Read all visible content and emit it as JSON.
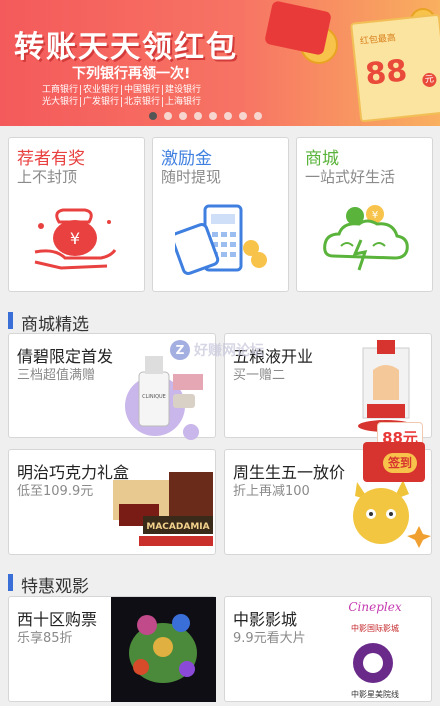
{
  "banner": {
    "title": "转账天天领红包",
    "subtitle": "下列银行再领一次!",
    "banks_row1": [
      "工商银行",
      "农业银行",
      "中国银行",
      "建设银行"
    ],
    "banks_row2": [
      "光大银行",
      "广发银行",
      "北京银行",
      "上海银行"
    ],
    "envelope_label": "红包最高",
    "envelope_amount": "88",
    "envelope_unit": "元",
    "coin_symbol": "¥",
    "carousel": {
      "total": 8,
      "active": 0
    }
  },
  "features": [
    {
      "title": "荐者有奖",
      "subtitle": "上不封顶",
      "color": "#e8413f",
      "icon": "money-bag-hand-icon"
    },
    {
      "title": "激励金",
      "subtitle": "随时提现",
      "color": "#3f7fe0",
      "icon": "phone-card-pos-icon"
    },
    {
      "title": "商城",
      "subtitle": "一站式好生活",
      "color": "#5ab33a",
      "icon": "cloud-coins-icon"
    }
  ],
  "sections": {
    "mall": "商城精选",
    "movies": "特惠观影"
  },
  "mall_items": [
    {
      "title": "倩碧限定首发",
      "subtitle": "三档超值满赠"
    },
    {
      "title": "五粮液开业",
      "subtitle": "买一赠二"
    },
    {
      "title": "明治巧克力礼盒",
      "subtitle": "低至109.9元"
    },
    {
      "title": "周生生五一放价",
      "subtitle": "折上再减100"
    }
  ],
  "movie_items": [
    {
      "title": "西十区购票",
      "subtitle": "乐享85折"
    },
    {
      "title": "中影影城",
      "subtitle": "9.9元看大片"
    }
  ],
  "product_labels": {
    "clinique": "CLINIQUE",
    "macadamia": "MACADAMIA",
    "cinema_logo_1": "中影国际影城",
    "cinema_logo_2": "中影星美院线"
  },
  "float_coupon": {
    "amount": "88元",
    "button": "签到"
  },
  "watermark": {
    "logo": "Z",
    "text": "好赚网论坛"
  },
  "colors": {
    "accent_blue": "#3a6fd8",
    "red": "#e8413f",
    "green": "#5ab33a"
  }
}
